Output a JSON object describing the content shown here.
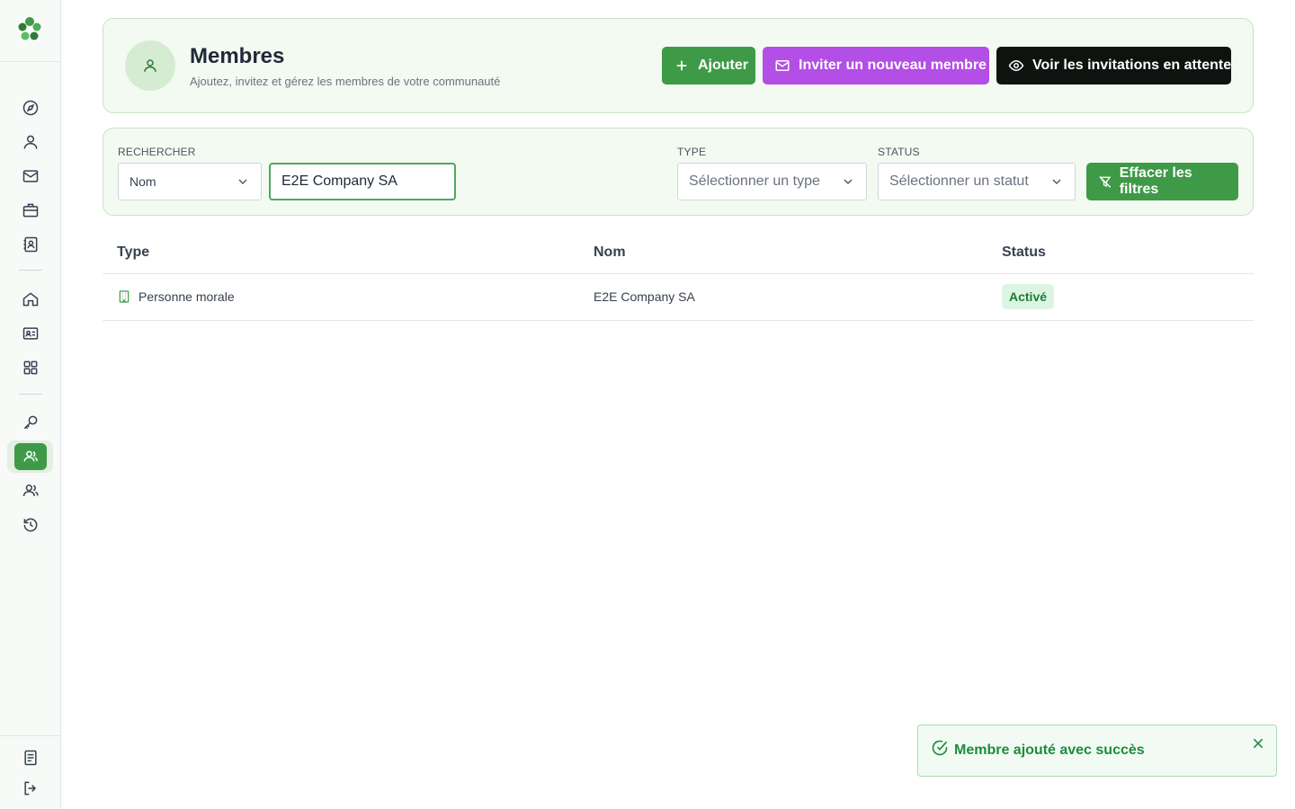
{
  "header": {
    "title": "Membres",
    "subtitle": "Ajoutez, invitez et gérez les membres de votre communauté",
    "add_label": "Ajouter",
    "invite_label": "Inviter un nouveau membre",
    "pending_label": "Voir les invitations en attente"
  },
  "filters": {
    "search_label": "RECHERCHER",
    "search_field_value": "Nom",
    "search_value": "E2E Company SA",
    "type_label": "TYPE",
    "type_placeholder": "Sélectionner un type",
    "status_label": "STATUS",
    "status_placeholder": "Sélectionner un statut",
    "clear_label": "Effacer les filtres"
  },
  "table": {
    "headers": [
      "Type",
      "Nom",
      "Status"
    ],
    "rows": [
      {
        "type": "Personne morale",
        "name": "E2E Company SA",
        "status": "Activé"
      }
    ]
  },
  "toast": {
    "message": "Membre ajouté avec succès"
  },
  "colors": {
    "primary": "#3e9a47",
    "invite": "#b34ee6",
    "dark": "#0e130f",
    "card_bg": "#f3faf2"
  },
  "sidebar": {
    "icons": [
      "compass-icon",
      "user-icon",
      "mail-icon",
      "briefcase-icon",
      "contact-book-icon",
      "home-icon",
      "id-card-icon",
      "grid-icon",
      "key-icon",
      "members-icon",
      "users-icon",
      "history-icon",
      "document-icon",
      "logout-icon"
    ],
    "active": "members-icon"
  }
}
